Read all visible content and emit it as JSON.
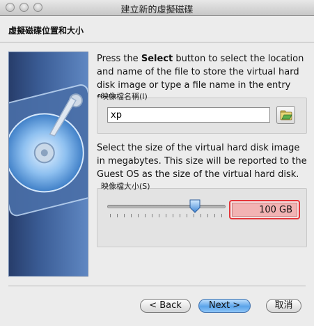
{
  "window": {
    "title": "建立新的虛擬磁碟"
  },
  "page": {
    "heading": "虛擬磁碟位置和大小"
  },
  "location": {
    "description_pre": "Press the ",
    "description_bold": "Select",
    "description_post": " button to select the location and name of the file to store the virtual hard disk image or type a file name in the entry field.",
    "label": "映像檔名稱(I)",
    "value": "xp",
    "select_icon": "folder-open-icon"
  },
  "size": {
    "description": "Select the size of the virtual hard disk image in megabytes. This size will be reported to the Guest OS as the size of the virtual hard disk.",
    "label": "映像檔大小(S)",
    "value": "100 GB",
    "slider_fraction": 0.75,
    "field_highlight_color": "#e4373b"
  },
  "buttons": {
    "back": "< Back",
    "next": "Next >",
    "cancel": "取消"
  },
  "colors": {
    "default_button": "#5ba3e9",
    "side_panel": "#3b5d96"
  }
}
